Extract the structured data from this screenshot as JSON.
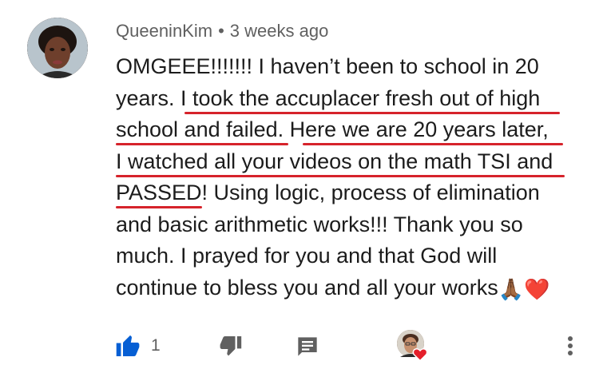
{
  "comment": {
    "author": "QueeninKim",
    "separator": "•",
    "time_ago": "3 weeks ago",
    "lines": [
      "OMGEEE!!!!!!!  I haven’t been to school in 20",
      "years.  I took the accuplacer fresh out of high",
      "school and failed.  Here we are 20 years later,",
      "I watched all your videos on the math TSI and",
      "PASSED!  Using logic, process of elimination",
      "and basic arithmetic works!!!  Thank you so",
      "much.  I prayed for you and that God will",
      "continue to bless you and all your works"
    ],
    "end_emojis": "🙏🏾❤️"
  },
  "actions": {
    "like_count": "1",
    "icons": [
      "thumb-up-icon",
      "thumb-down-icon",
      "reply-icon",
      "creator-heart-icon",
      "more-vert-icon"
    ]
  },
  "colors": {
    "accent_blue": "#065fd4",
    "underline_red": "#d6232b",
    "meta_gray": "#606060"
  }
}
